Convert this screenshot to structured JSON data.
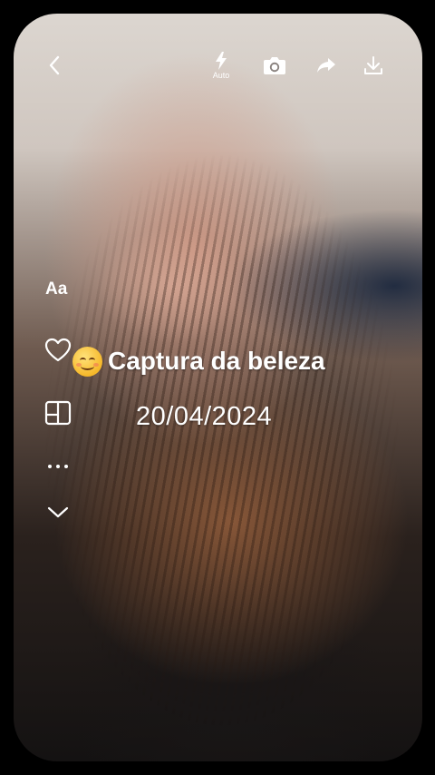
{
  "toolbar": {
    "back_icon": "chevron-left-icon",
    "flash_icon": "flash-icon",
    "flash_mode": "Auto",
    "camera_icon": "camera-icon",
    "share_icon": "share-arrow-icon",
    "download_icon": "download-icon"
  },
  "side_tools": {
    "text_style_label": "Aa",
    "like_icon": "heart-icon",
    "layout_icon": "layout-grid-icon",
    "more_icon": "more-dots-icon",
    "collapse_icon": "chevron-down-icon"
  },
  "overlay": {
    "caption": "Captura da beleza",
    "caption_emoji": "smiling-face",
    "date": "20/04/2024"
  },
  "colors": {
    "background": "#000000",
    "text": "#ffffff",
    "emoji": "#f6b82a"
  }
}
